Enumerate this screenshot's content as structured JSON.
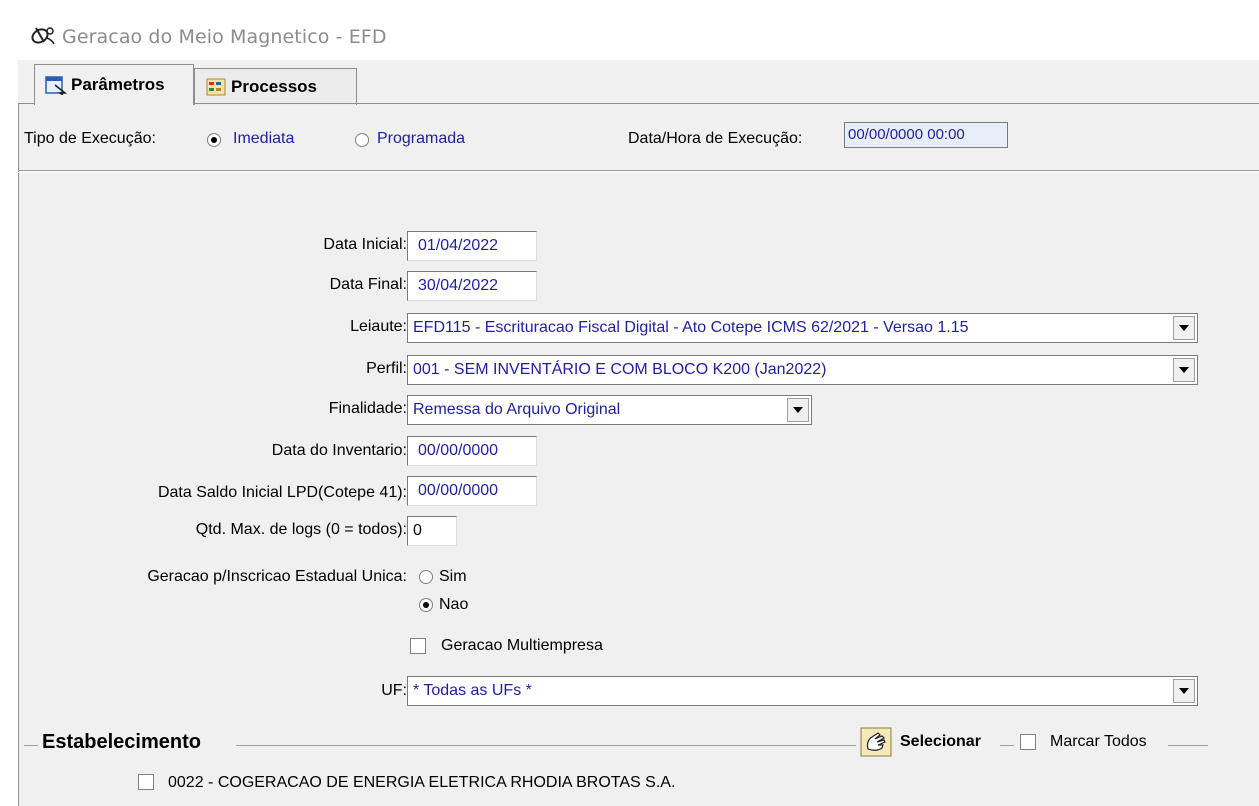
{
  "window": {
    "title": "Geracao do Meio Magnetico - EFD"
  },
  "tabs": [
    {
      "label": "Parâmetros",
      "active": true,
      "icon": "parameters-icon"
    },
    {
      "label": "Processos",
      "active": false,
      "icon": "processes-icon"
    }
  ],
  "execution": {
    "type_label": "Tipo de Execução:",
    "option_immediate": "Imediata",
    "option_scheduled": "Programada",
    "selected": "Imediata",
    "datetime_label": "Data/Hora de Execução:",
    "datetime_value": "00/00/0000 00:00"
  },
  "form": {
    "data_inicial_label": "Data Inicial:",
    "data_inicial_value": "01/04/2022",
    "data_final_label": "Data Final:",
    "data_final_value": "30/04/2022",
    "leiaute_label": "Leiaute:",
    "leiaute_value": "EFD115 - Escrituracao Fiscal Digital - Ato Cotepe ICMS 62/2021 - Versao 1.15",
    "perfil_label": "Perfil:",
    "perfil_value": "001 - SEM INVENTÁRIO E COM BLOCO K200 (Jan2022)",
    "finalidade_label": "Finalidade:",
    "finalidade_value": "Remessa do Arquivo Original",
    "data_inventario_label": "Data do Inventario:",
    "data_inventario_value": "00/00/0000",
    "data_saldo_label": "Data Saldo Inicial LPD(Cotepe 41):",
    "data_saldo_value": "00/00/0000",
    "qtd_logs_label": "Qtd. Max. de logs (0 = todos):",
    "qtd_logs_value": "0",
    "ie_unica_label": "Geracao p/Inscricao Estadual Unica:",
    "ie_unica_sim": "Sim",
    "ie_unica_nao": "Nao",
    "ie_unica_selected": "Nao",
    "multiempresa_label": "Geracao Multiempresa",
    "multiempresa_checked": false,
    "uf_label": "UF:",
    "uf_value": "* Todas as UFs *"
  },
  "estabelecimento": {
    "title": "Estabelecimento",
    "select_label": "Selecionar",
    "mark_all_label": "Marcar Todos",
    "mark_all_checked": false,
    "items": [
      {
        "label": "0022 - COGERACAO DE ENERGIA ELETRICA RHODIA BROTAS S.A.",
        "checked": false
      }
    ]
  }
}
